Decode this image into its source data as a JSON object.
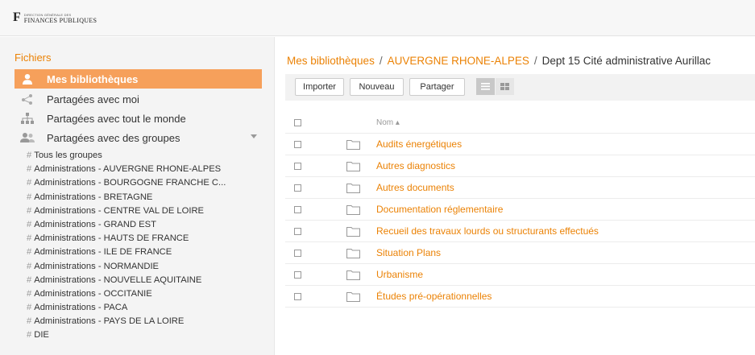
{
  "header": {
    "logo_mark": "F",
    "logo_small": "DIRECTION GÉNÉRALE DES",
    "logo_big": "FINANCES PUBLIQUES"
  },
  "sidebar": {
    "title": "Fichiers",
    "nav": [
      {
        "label": "Mes bibliothèques",
        "icon": "user-icon",
        "active": true
      },
      {
        "label": "Partagées avec moi",
        "icon": "share-icon",
        "active": false
      },
      {
        "label": "Partagées avec tout le monde",
        "icon": "org-chart-icon",
        "active": false
      },
      {
        "label": "Partagées avec des groupes",
        "icon": "group-icon",
        "active": false
      }
    ],
    "groups": [
      "Tous les groupes",
      "Administrations - AUVERGNE RHONE-ALPES",
      "Administrations - BOURGOGNE FRANCHE C...",
      "Administrations - BRETAGNE",
      "Administrations - CENTRE VAL DE LOIRE",
      "Administrations - GRAND EST",
      "Administrations - HAUTS DE FRANCE",
      "Administrations - ILE DE FRANCE",
      "Administrations - NORMANDIE",
      "Administrations - NOUVELLE AQUITAINE",
      "Administrations - OCCITANIE",
      "Administrations - PACA",
      "Administrations - PAYS DE LA LOIRE",
      "DIE"
    ],
    "group_prefix": "#"
  },
  "breadcrumb": {
    "root": "Mes bibliothèques",
    "library": "AUVERGNE RHONE-ALPES",
    "current": "Dept 15 Cité administrative Aurillac",
    "separator": "/"
  },
  "toolbar": {
    "import_label": "Importer",
    "new_label": "Nouveau",
    "share_label": "Partager"
  },
  "table": {
    "name_header": "Nom ▴",
    "rows": [
      "Audits énergétiques",
      "Autres diagnostics",
      "Autres documents",
      "Documentation réglementaire",
      "Recueil des travaux lourds ou structurants effectués",
      "Situation Plans",
      "Urbanisme",
      "Études pré-opérationnelles"
    ]
  },
  "colors": {
    "accent": "#eb8205",
    "active_bg": "#f6a05b"
  }
}
